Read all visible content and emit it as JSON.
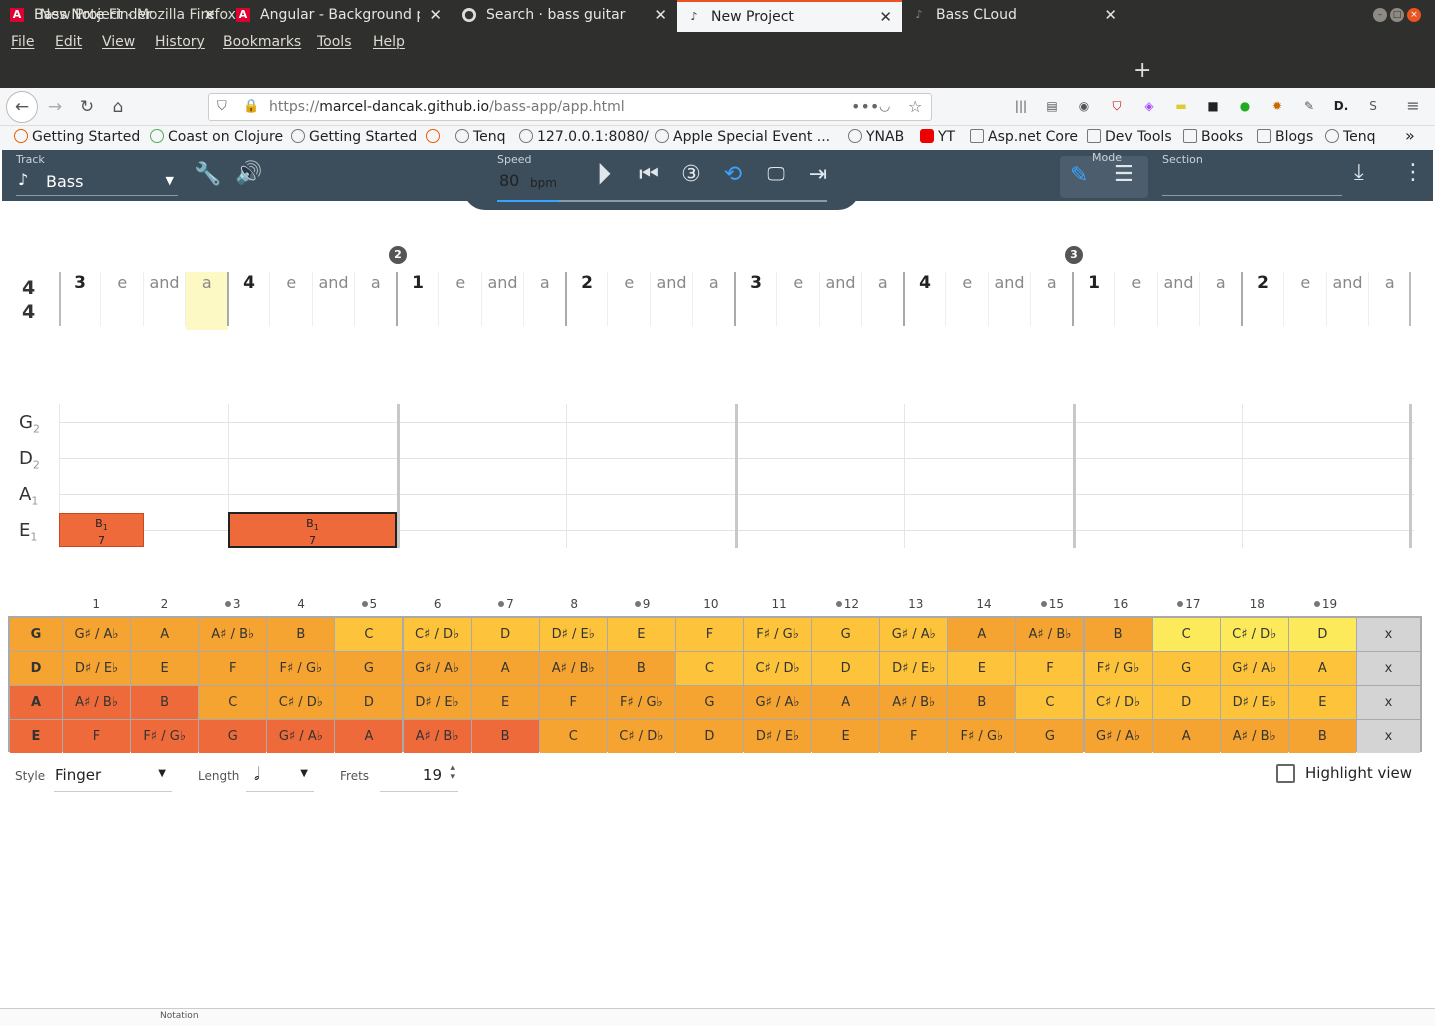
{
  "window": {
    "title": "New Project - Mozilla Firefox"
  },
  "menu": [
    "File",
    "Edit",
    "View",
    "History",
    "Bookmarks",
    "Tools",
    "Help"
  ],
  "tabs": [
    {
      "label": "Bass Note Finder",
      "icon": "angular-icon"
    },
    {
      "label": "Angular - Background pr",
      "icon": "angular-icon"
    },
    {
      "label": "Search · bass guitar",
      "icon": "github-icon"
    },
    {
      "label": "New Project",
      "icon": "bass-icon",
      "active": true
    },
    {
      "label": "Bass CLoud",
      "icon": "bass-icon"
    }
  ],
  "url": {
    "prefix": "https://",
    "host": "marcel-dancak.github.io",
    "path": "/bass-app/app.html"
  },
  "bookmarks": [
    "Getting Started",
    "Coast on Clojure",
    "Getting Started",
    "Tenq",
    "127.0.0.1:8080/",
    "Apple Special Event ...",
    "YNAB",
    "YT",
    "Asp.net Core",
    "Dev Tools",
    "Books",
    "Blogs",
    "Tenq"
  ],
  "app": {
    "track_label": "Track",
    "track_value": "Bass",
    "speed_label": "Speed",
    "speed_value": "80",
    "speed_unit": "bpm",
    "mode_label": "Mode",
    "section_label": "Section",
    "section_value": ""
  },
  "time_signature": {
    "top": "4",
    "bottom": "4"
  },
  "bar_numbers": [
    "2",
    "3"
  ],
  "beat_labels": [
    "3",
    "e",
    "and",
    "a",
    "4",
    "e",
    "and",
    "a",
    "1",
    "e",
    "and",
    "a",
    "2",
    "e",
    "and",
    "a",
    "3",
    "e",
    "and",
    "a",
    "4",
    "e",
    "and",
    "a",
    "1",
    "e",
    "and",
    "a",
    "2",
    "e",
    "and",
    "a"
  ],
  "highlighted_beat": 3,
  "strings": [
    {
      "name": "G",
      "octave": "2"
    },
    {
      "name": "D",
      "octave": "2"
    },
    {
      "name": "A",
      "octave": "1"
    },
    {
      "name": "E",
      "octave": "1"
    }
  ],
  "notes": [
    {
      "label": "B",
      "octave": "1",
      "fret": "7"
    },
    {
      "label": "B",
      "octave": "1",
      "fret": "7"
    }
  ],
  "fret_numbers": [
    "1",
    "2",
    "3",
    "4",
    "5",
    "6",
    "7",
    "8",
    "9",
    "10",
    "11",
    "12",
    "13",
    "14",
    "15",
    "16",
    "17",
    "18",
    "19"
  ],
  "fret_markers": [
    3,
    5,
    7,
    9,
    12,
    15,
    17,
    19
  ],
  "fretboard": [
    {
      "string": "G",
      "notes": [
        "G♯ / A♭",
        "A",
        "A♯ / B♭",
        "B",
        "C",
        "C♯ / D♭",
        "D",
        "D♯ / E♭",
        "E",
        "F",
        "F♯ / G♭",
        "G",
        "G♯ / A♭",
        "A",
        "A♯ / B♭",
        "B",
        "C",
        "C♯ / D♭",
        "D"
      ],
      "mute": "x"
    },
    {
      "string": "D",
      "notes": [
        "D♯ / E♭",
        "E",
        "F",
        "F♯ / G♭",
        "G",
        "G♯ / A♭",
        "A",
        "A♯ / B♭",
        "B",
        "C",
        "C♯ / D♭",
        "D",
        "D♯ / E♭",
        "E",
        "F",
        "F♯ / G♭",
        "G",
        "G♯ / A♭",
        "A"
      ],
      "mute": "x"
    },
    {
      "string": "A",
      "notes": [
        "A♯ / B♭",
        "B",
        "C",
        "C♯ / D♭",
        "D",
        "D♯ / E♭",
        "E",
        "F",
        "F♯ / G♭",
        "G",
        "G♯ / A♭",
        "A",
        "A♯ / B♭",
        "B",
        "C",
        "C♯ / D♭",
        "D",
        "D♯ / E♭",
        "E"
      ],
      "mute": "x"
    },
    {
      "string": "E",
      "notes": [
        "F",
        "F♯ / G♭",
        "G",
        "G♯ / A♭",
        "A",
        "A♯ / B♭",
        "B",
        "C",
        "C♯ / D♭",
        "D",
        "D♯ / E♭",
        "E",
        "F",
        "F♯ / G♭",
        "G",
        "G♯ / A♭",
        "A",
        "A♯ / B♭",
        "B"
      ],
      "mute": "x"
    }
  ],
  "fretboard_colors": {
    "G": [
      "#f5a431",
      "#f5a431",
      "#f5a431",
      "#f5a431",
      "#fcc33b",
      "#fcc33b",
      "#fcc33b",
      "#fcc33b",
      "#fcc33b",
      "#fcc33b",
      "#fcc33b",
      "#fcc33b",
      "#fcc33b",
      "#f5a431",
      "#f5a431",
      "#f5a431",
      "#fdea5a",
      "#fdea5a",
      "#fdea5a"
    ],
    "D": [
      "#f5a431",
      "#f5a431",
      "#f5a431",
      "#f5a431",
      "#f5a431",
      "#f5a431",
      "#f5a431",
      "#f5a431",
      "#f5a431",
      "#fcc33b",
      "#fcc33b",
      "#fcc33b",
      "#fcc33b",
      "#fcc33b",
      "#fcc33b",
      "#fcc33b",
      "#fcc33b",
      "#fcc33b",
      "#fcc33b"
    ],
    "A": [
      "#ee6a3a",
      "#ee6a3a",
      "#f5a431",
      "#f5a431",
      "#f5a431",
      "#f5a431",
      "#f5a431",
      "#f5a431",
      "#f5a431",
      "#f5a431",
      "#f5a431",
      "#f5a431",
      "#f5a431",
      "#f5a431",
      "#fcc33b",
      "#fcc33b",
      "#fcc33b",
      "#fcc33b",
      "#fcc33b"
    ],
    "E": [
      "#ee6a3a",
      "#ee6a3a",
      "#ee6a3a",
      "#ee6a3a",
      "#ee6a3a",
      "#ee6a3a",
      "#ee6a3a",
      "#f5a431",
      "#f5a431",
      "#f5a431",
      "#f5a431",
      "#f5a431",
      "#f5a431",
      "#f5a431",
      "#f5a431",
      "#f5a431",
      "#f5a431",
      "#f5a431",
      "#f5a431"
    ]
  },
  "options": {
    "style_label": "Style",
    "style_value": "Finger",
    "length_label": "Length",
    "length_value": "𝅗𝅥",
    "frets_label": "Frets",
    "frets_value": "19",
    "highlight_label": "Highlight view"
  },
  "status": {
    "notation_label": "Notation"
  }
}
